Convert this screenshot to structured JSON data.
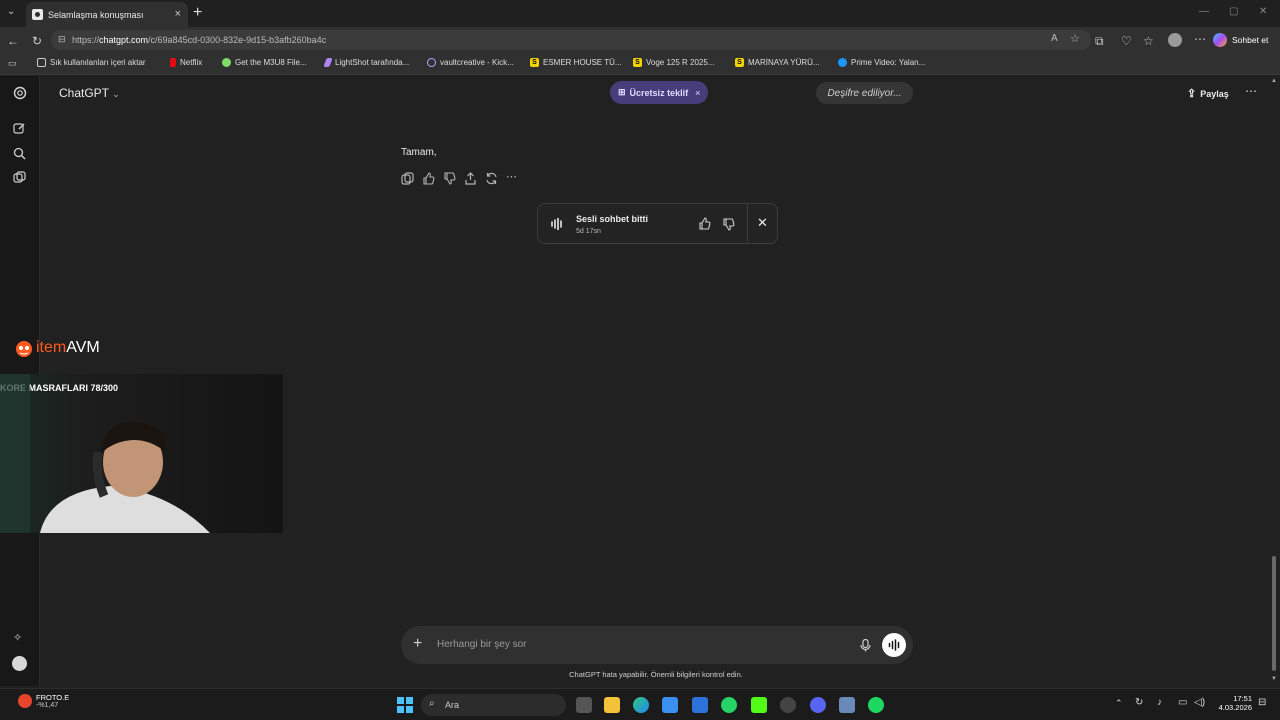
{
  "browser": {
    "tab_title": "Selamlaşma konuşması",
    "url_prefix": "https://",
    "url_domain": "chatgpt.com",
    "url_path": "/c/69a845cd-0300-832e-9d15-b3afb260ba4c",
    "copilot_label": "Sohbet et"
  },
  "bookmarks": [
    {
      "label": "Sık kullanılanları içeri aktar",
      "icon": "import-icon"
    },
    {
      "label": "Netflix",
      "icon": "netflix-icon"
    },
    {
      "label": "Get the M3U8 File...",
      "icon": "green-circle-icon"
    },
    {
      "label": "LightShot tarafında...",
      "icon": "feather-icon"
    },
    {
      "label": "vaultcreative - Kick...",
      "icon": "vault-icon"
    },
    {
      "label": "ESMER HOUSE TÜ...",
      "icon": "s-icon"
    },
    {
      "label": "Voge 125 R 2025...",
      "icon": "s-icon"
    },
    {
      "label": "MARİNAYA YÜRÜ...",
      "icon": "s-icon"
    },
    {
      "label": "Prime Video: Yalan...",
      "icon": "prime-icon"
    }
  ],
  "header": {
    "model": "ChatGPT",
    "promo": "Ücretsiz teklif",
    "status": "Deşifre ediliyor...",
    "share": "Paylaş"
  },
  "conversation": {
    "assistant_message": "Tamam,",
    "voice_card_title": "Sesli sohbet bitti",
    "voice_card_duration": "5d 17sn"
  },
  "composer": {
    "placeholder": "Herhangi bir şey sor",
    "disclaimer": "ChatGPT hata yapabilir. Önemli bilgileri kontrol edin."
  },
  "overlay": {
    "brand_item": "item",
    "brand_avm": "AVM",
    "webcam_caption": "KORE MASRAFLARI 78/300"
  },
  "taskbar": {
    "search": "Ara",
    "stock_name": "FROTO.E",
    "stock_change": "-%1,47",
    "time": "17:51",
    "date": "4.03.2026"
  }
}
